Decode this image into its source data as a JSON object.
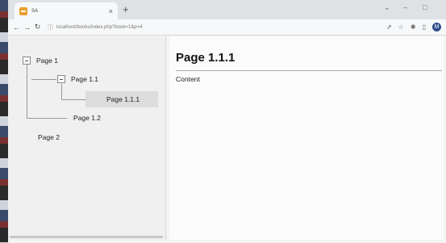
{
  "browser": {
    "tab_title": "SA",
    "tab_close": "×",
    "new_tab": "+",
    "url": "localhost/books/index.php?book=1&p=4",
    "window_controls": [
      "⌄",
      "–",
      "□"
    ]
  },
  "tree": {
    "page1": "Page 1",
    "page11": "Page 1.1",
    "page111": "Page 1.1.1",
    "page12": "Page 1.2",
    "page2": "Page 2"
  },
  "main": {
    "title": "Page 1.1.1",
    "content": "Content"
  }
}
